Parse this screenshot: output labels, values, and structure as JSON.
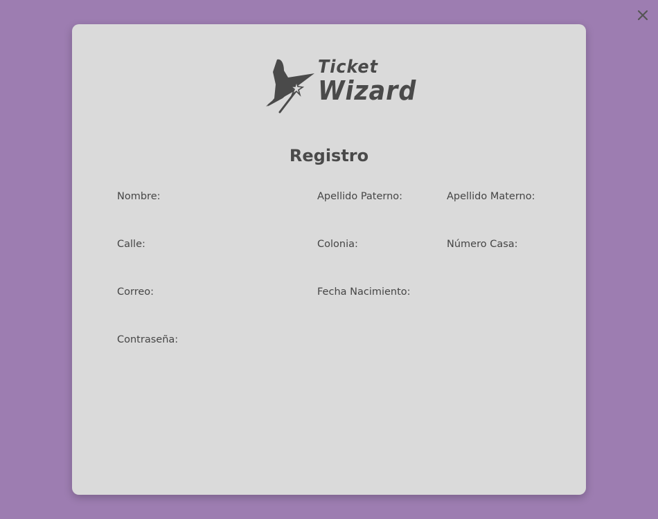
{
  "close_icon": "close-icon",
  "logo": {
    "line1": "Ticket",
    "line2": "Wizard",
    "icon": "wizard-hat-icon"
  },
  "form": {
    "title": "Registro",
    "fields": {
      "nombre": "Nombre:",
      "apellido_paterno": "Apellido Paterno:",
      "apellido_materno": "Apellido Materno:",
      "calle": "Calle:",
      "colonia": "Colonia:",
      "numero_casa": "Número Casa:",
      "correo": "Correo:",
      "fecha_nacimiento": "Fecha Nacimiento:",
      "contrasena": "Contraseña:"
    }
  },
  "colors": {
    "background": "#9d7db1",
    "card": "#dadada",
    "text": "#454545"
  }
}
